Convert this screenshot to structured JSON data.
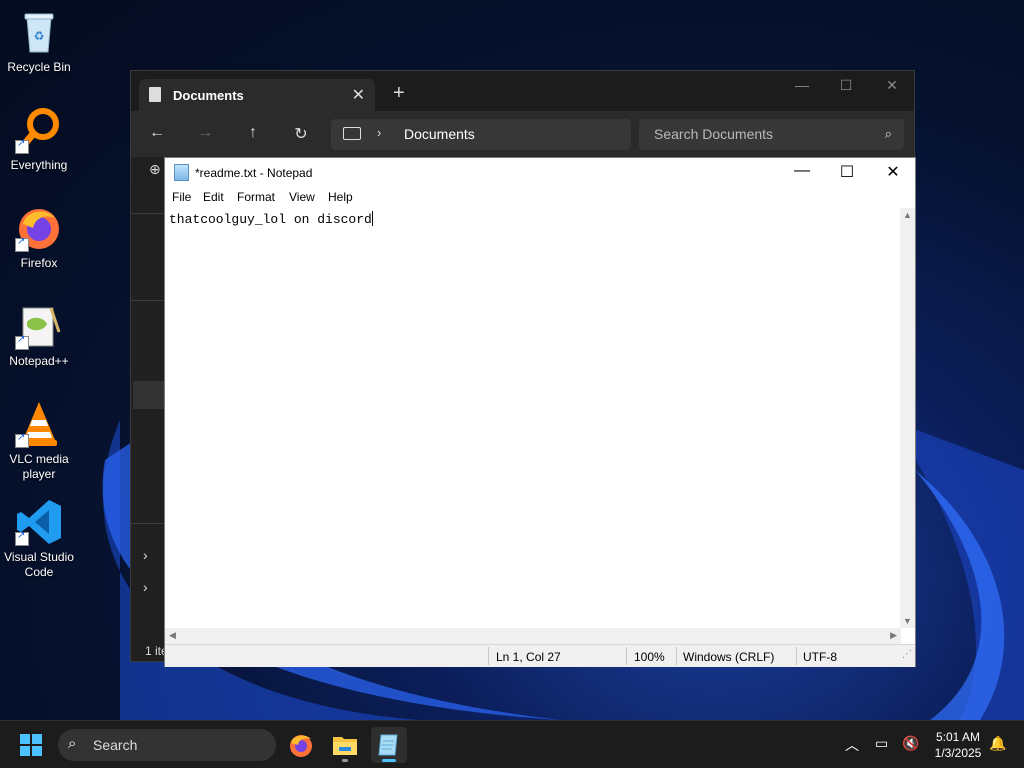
{
  "desktop": {
    "icons": [
      {
        "label": "Recycle Bin",
        "icon": "recycle-bin-icon"
      },
      {
        "label": "Everything",
        "icon": "everything-search-icon"
      },
      {
        "label": "Firefox",
        "icon": "firefox-icon"
      },
      {
        "label": "Notepad++",
        "icon": "notepadpp-icon"
      },
      {
        "label": "VLC media player",
        "icon": "vlc-icon"
      },
      {
        "label": "Visual Studio Code",
        "icon": "vscode-icon"
      }
    ]
  },
  "explorer": {
    "tab_title": "Documents",
    "address_path": "Documents",
    "search_placeholder": "Search Documents",
    "status_text": "1 ite",
    "theme_bg": "#202020"
  },
  "notepad": {
    "title": "*readme.txt - Notepad",
    "menu": [
      "File",
      "Edit",
      "Format",
      "View",
      "Help"
    ],
    "content": "thatcoolguy_lol on discord",
    "status": {
      "position": "Ln 1, Col 27",
      "zoom": "100%",
      "line_ending": "Windows (CRLF)",
      "encoding": "UTF-8"
    }
  },
  "taskbar": {
    "search_placeholder": "Search",
    "accent": "#4cc2ff",
    "apps": [
      "firefox-icon",
      "file-explorer-icon",
      "notepad-icon"
    ],
    "time": "5:01 AM",
    "date": "1/3/2025"
  }
}
